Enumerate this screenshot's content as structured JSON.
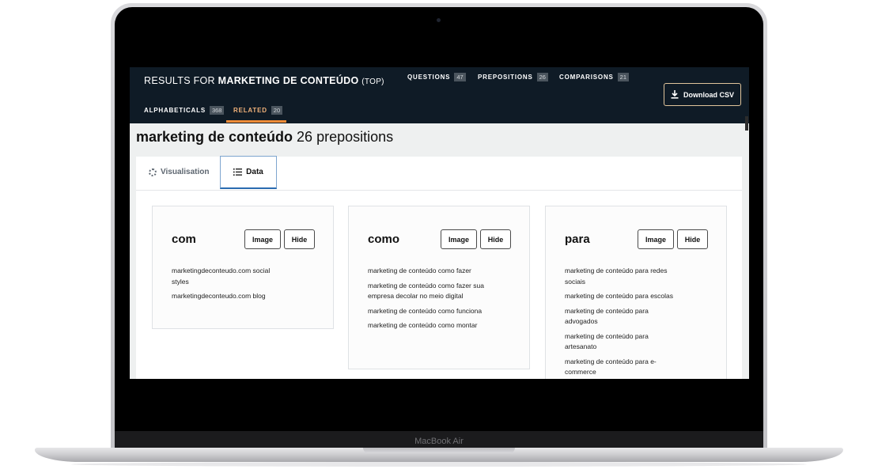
{
  "device": {
    "model_label": "MacBook Air"
  },
  "header": {
    "results_prefix": "RESULTS FOR",
    "keyword": "MARKETING DE CONTEÚDO",
    "region": "(TOP)",
    "tabs": [
      {
        "label": "QUESTIONS",
        "count": "47"
      },
      {
        "label": "PREPOSITIONS",
        "count": "26"
      },
      {
        "label": "COMPARISONS",
        "count": "21"
      },
      {
        "label": "ALPHABETICALS",
        "count": "368"
      },
      {
        "label": "RELATED",
        "count": "20",
        "active": true
      }
    ],
    "download_label": "Download CSV"
  },
  "page": {
    "keyword": "marketing de conteúdo",
    "summary": "26 prepositions"
  },
  "view_tabs": {
    "visualisation": "Visualisation",
    "data": "Data",
    "active": "Data"
  },
  "cards": [
    {
      "title": "com",
      "image_label": "Image",
      "hide_label": "Hide",
      "items": [
        "marketingdeconteudo.com social styles",
        "marketingdeconteudo.com blog"
      ]
    },
    {
      "title": "como",
      "image_label": "Image",
      "hide_label": "Hide",
      "items": [
        "marketing de conteúdo como fazer",
        "marketing de conteúdo como fazer sua empresa decolar no meio digital",
        "marketing de conteúdo como funciona",
        "marketing de conteúdo como montar"
      ]
    },
    {
      "title": "para",
      "image_label": "Image",
      "hide_label": "Hide",
      "items": [
        "marketing de conteúdo para redes sociais",
        "marketing de conteúdo para escolas",
        "marketing de conteúdo para advogados",
        "marketing de conteúdo para artesanato",
        "marketing de conteúdo para e-commerce"
      ]
    }
  ],
  "colors": {
    "header_bg": "#0f1b26",
    "active_tab_accent": "#f28c38",
    "data_tab_border": "#2a6bb0"
  }
}
